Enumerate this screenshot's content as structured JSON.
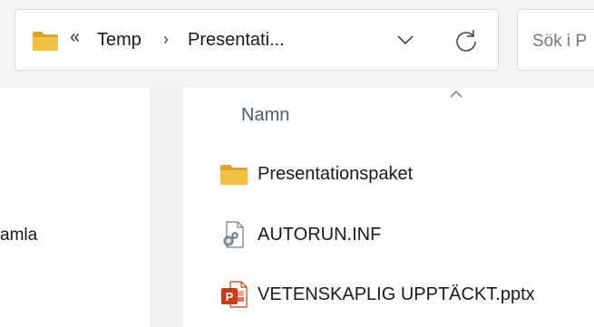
{
  "address_bar": {
    "folder_icon": "folder-icon",
    "overflow_glyph": "«",
    "crumbs": [
      {
        "label": "Temp"
      },
      {
        "label": "Presentati..."
      }
    ],
    "separator_glyph": "›",
    "dropdown_icon": "chevron-down-icon",
    "refresh_icon": "refresh-icon"
  },
  "search": {
    "placeholder": "Sök i P"
  },
  "nav_pane": {
    "partial_label": "amla"
  },
  "file_list": {
    "sort_indicator": "sort-ascending-icon",
    "columns": [
      {
        "label": "Namn"
      }
    ],
    "items": [
      {
        "name": "Presentationspaket",
        "icon": "folder-icon"
      },
      {
        "name": "AUTORUN.INF",
        "icon": "settings-file-icon"
      },
      {
        "name": "VETENSKAPLIG UPPTÄCKT.pptx",
        "icon": "powerpoint-icon"
      }
    ]
  },
  "colors": {
    "folder": "#f2c043",
    "folder_dark": "#dca530",
    "powerpoint": "#c43e1c",
    "header_text": "#4a5a6e",
    "chrome_bg": "#f3f3f3"
  }
}
